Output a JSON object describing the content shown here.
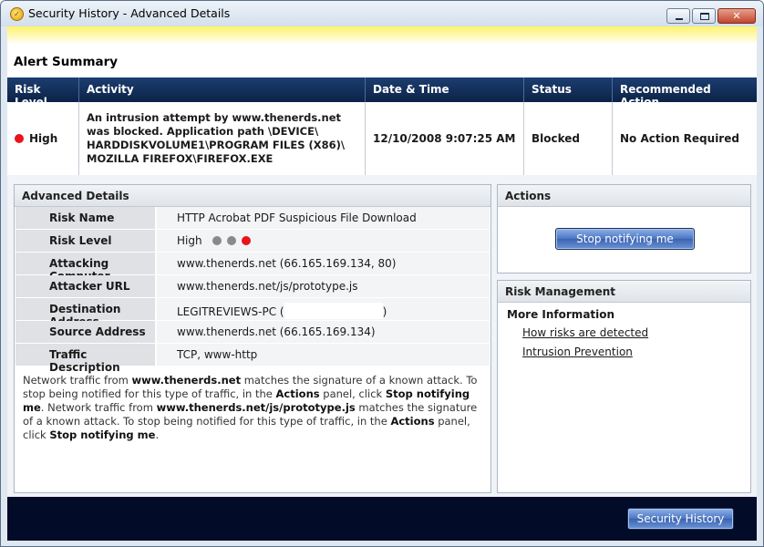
{
  "window": {
    "title": "Security History - Advanced Details"
  },
  "summary": {
    "title": "Alert Summary",
    "headers": [
      "Risk Level",
      "Activity",
      "Date & Time",
      "Status",
      "Recommended Action"
    ],
    "row": {
      "risk_level": "High",
      "activity": "An intrusion attempt by www.thenerds.net was blocked. Application path \\DEVICE\\ HARDDISKVOLUME1\\PROGRAM FILES (X86)\\ MOZILLA FIREFOX\\FIREFOX.EXE",
      "datetime": "12/10/2008 9:07:25 AM",
      "status": "Blocked",
      "recommended_action": "No Action Required"
    }
  },
  "advanced": {
    "title": "Advanced Details",
    "rows": [
      {
        "label": "Risk Name",
        "value": "HTTP Acrobat PDF Suspicious File Download"
      },
      {
        "label": "Risk Level",
        "value": "High"
      },
      {
        "label": "Attacking Computer",
        "value": "www.thenerds.net (66.165.169.134, 80)"
      },
      {
        "label": "Attacker URL",
        "value": "www.thenerds.net/js/prototype.js"
      },
      {
        "label": "Destination Address",
        "value": "LEGITREVIEWS-PC (",
        "value_end": ")"
      },
      {
        "label": "Source Address",
        "value": "www.thenerds.net (66.165.169.134)"
      },
      {
        "label": "Traffic Description",
        "value": "TCP, www-http"
      }
    ],
    "description": {
      "p1": "Network traffic from ",
      "b1": "www.thenerds.net",
      "p2": " matches the signature of a known attack. To stop being notified for this type of traffic, in the ",
      "b2": "Actions",
      "p3": " panel, click ",
      "b3": "Stop notifying me",
      "p4": ". Network traffic from ",
      "b4": "www.thenerds.net/js/prototype.js",
      "p5": " matches the signature of a known attack. To stop being notified for this type of traffic, in the ",
      "b5": "Actions",
      "p6": " panel, click ",
      "b6": "Stop notifying me",
      "p7": "."
    }
  },
  "actions": {
    "title": "Actions",
    "stop_button": "Stop notifying me"
  },
  "risk_management": {
    "title": "Risk Management",
    "more_info": "More Information",
    "links": [
      "How risks are detected",
      "Intrusion Prevention"
    ]
  },
  "footer": {
    "history_button": "Security History"
  },
  "colors": {
    "header_bg": "#0c2247",
    "high_risk": "#e8141a",
    "footer_bg": "#020b27",
    "accent_yellow": "#fff36a"
  }
}
